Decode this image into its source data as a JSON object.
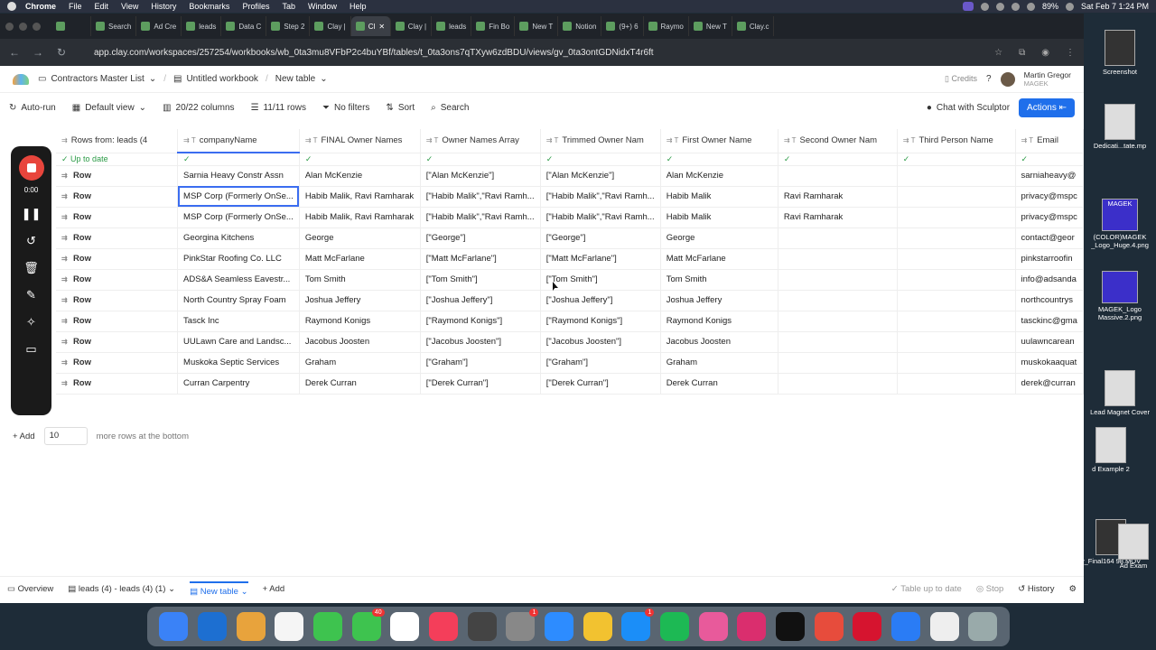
{
  "menubar": {
    "items": [
      "Chrome",
      "File",
      "Edit",
      "View",
      "History",
      "Bookmarks",
      "Profiles",
      "Tab",
      "Window",
      "Help"
    ],
    "battery": "89%",
    "datetime": "Sat Feb 7  1:24 PM"
  },
  "browser": {
    "tabs": [
      "Search",
      "Ad Cre",
      "leads",
      "Data C",
      "Step 2",
      "Clay |",
      "Cl",
      "Clay |",
      "leads",
      "Fin Bo",
      "New T",
      "Notion",
      "(9+) 6",
      "Raymo",
      "New T",
      "Clay.c"
    ],
    "url": "app.clay.com/workspaces/257254/workbooks/wb_0ta3mu8VFbP2c4buYBf/tables/t_0ta3ons7qTXyw6zdBDU/views/gv_0ta3ontGDNidxT4r6ft"
  },
  "clay": {
    "breadcrumb": [
      "Contractors Master List",
      "Untitled workbook",
      "New table"
    ],
    "credits_label": "Credits",
    "user_name": "Martin Gregor",
    "user_org": "MAGEK",
    "toolbar": {
      "autorun": "Auto-run",
      "default_view": "Default view",
      "columns": "20/22 columns",
      "rows": "11/11 rows",
      "filters": "No filters",
      "sort": "Sort",
      "search": "Search",
      "sculptor": "Chat with Sculptor",
      "actions": "Actions"
    },
    "columns": [
      "Rows from: leads (4",
      "companyName",
      "FINAL Owner Names",
      "Owner Names Array",
      "Trimmed Owner Nam",
      "First Owner Name",
      "Second Owner Nam",
      "Third Person Name",
      "Email"
    ],
    "status_row_label": "Up to date",
    "row_label": "Row",
    "rows": [
      [
        "Sarnia Heavy Constr Assn",
        "Alan McKenzie",
        "[\"Alan McKenzie\"]",
        "[\"Alan McKenzie\"]",
        "Alan McKenzie",
        "",
        "",
        "sarniaheavy@"
      ],
      [
        "MSP Corp (Formerly OnSe...",
        "Habib Malik, Ravi Ramharak",
        "[\"Habib Malik\",\"Ravi Ramh...",
        "[\"Habib Malik\",\"Ravi Ramh...",
        "Habib Malik",
        "Ravi Ramharak",
        "",
        "privacy@mspc"
      ],
      [
        "MSP Corp (Formerly OnSe...",
        "Habib Malik, Ravi Ramharak",
        "[\"Habib Malik\",\"Ravi Ramh...",
        "[\"Habib Malik\",\"Ravi Ramh...",
        "Habib Malik",
        "Ravi Ramharak",
        "",
        "privacy@mspc"
      ],
      [
        "Georgina Kitchens",
        "George",
        "[\"George\"]",
        "[\"George\"]",
        "George",
        "",
        "",
        "contact@geor"
      ],
      [
        "PinkStar Roofing Co. LLC",
        "Matt McFarlane",
        "[\"Matt McFarlane\"]",
        "[\"Matt McFarlane\"]",
        "Matt McFarlane",
        "",
        "",
        "pinkstarroofin"
      ],
      [
        "ADS&A Seamless Eavestr...",
        "Tom Smith",
        "[\"Tom Smith\"]",
        "[\"Tom Smith\"]",
        "Tom Smith",
        "",
        "",
        "info@adsanda"
      ],
      [
        "North Country Spray Foam",
        "Joshua Jeffery",
        "[\"Joshua Jeffery\"]",
        "[\"Joshua Jeffery\"]",
        "Joshua Jeffery",
        "",
        "",
        "northcountrys"
      ],
      [
        "Tasck Inc",
        "Raymond Konigs",
        "[\"Raymond Konigs\"]",
        "[\"Raymond Konigs\"]",
        "Raymond Konigs",
        "",
        "",
        "tasckinc@gma"
      ],
      [
        "UULawn Care and Landsc...",
        "Jacobus Joosten",
        "[\"Jacobus Joosten\"]",
        "[\"Jacobus Joosten\"]",
        "Jacobus Joosten",
        "",
        "",
        "uulawncarean"
      ],
      [
        "Muskoka Septic Services",
        "Graham",
        "[\"Graham\"]",
        "[\"Graham\"]",
        "Graham",
        "",
        "",
        "muskokaaquat"
      ],
      [
        "Curran Carpentry",
        "Derek Curran",
        "[\"Derek Curran\"]",
        "[\"Derek Curran\"]",
        "Derek Curran",
        "",
        "",
        "derek@curran"
      ]
    ],
    "add_label": "Add",
    "add_count": "10",
    "add_suffix": "more rows at the bottom",
    "bottom": {
      "overview": "Overview",
      "leads_tab": "leads (4) - leads (4) (1)",
      "new_table_tab": "New table",
      "add": "Add",
      "table_status": "Table up to date",
      "stop": "Stop",
      "history": "History"
    }
  },
  "recorder": {
    "time": "0:00"
  },
  "desktop": {
    "files": [
      "Screenshot",
      "Dedicati...tate.mp",
      "(COLOR)MAGEK _Logo_Huge.4.png",
      "MAGEK_Logo Massive.2.png",
      "Lead Magnet Cover",
      "d Example 2",
      "y_Final164 98.MOV",
      "Ad Exam"
    ],
    "magek_logo_text": "MAGEK"
  },
  "dock": {
    "badge_messages": "40",
    "badge_settings": "1",
    "badge_appstore": "1"
  }
}
